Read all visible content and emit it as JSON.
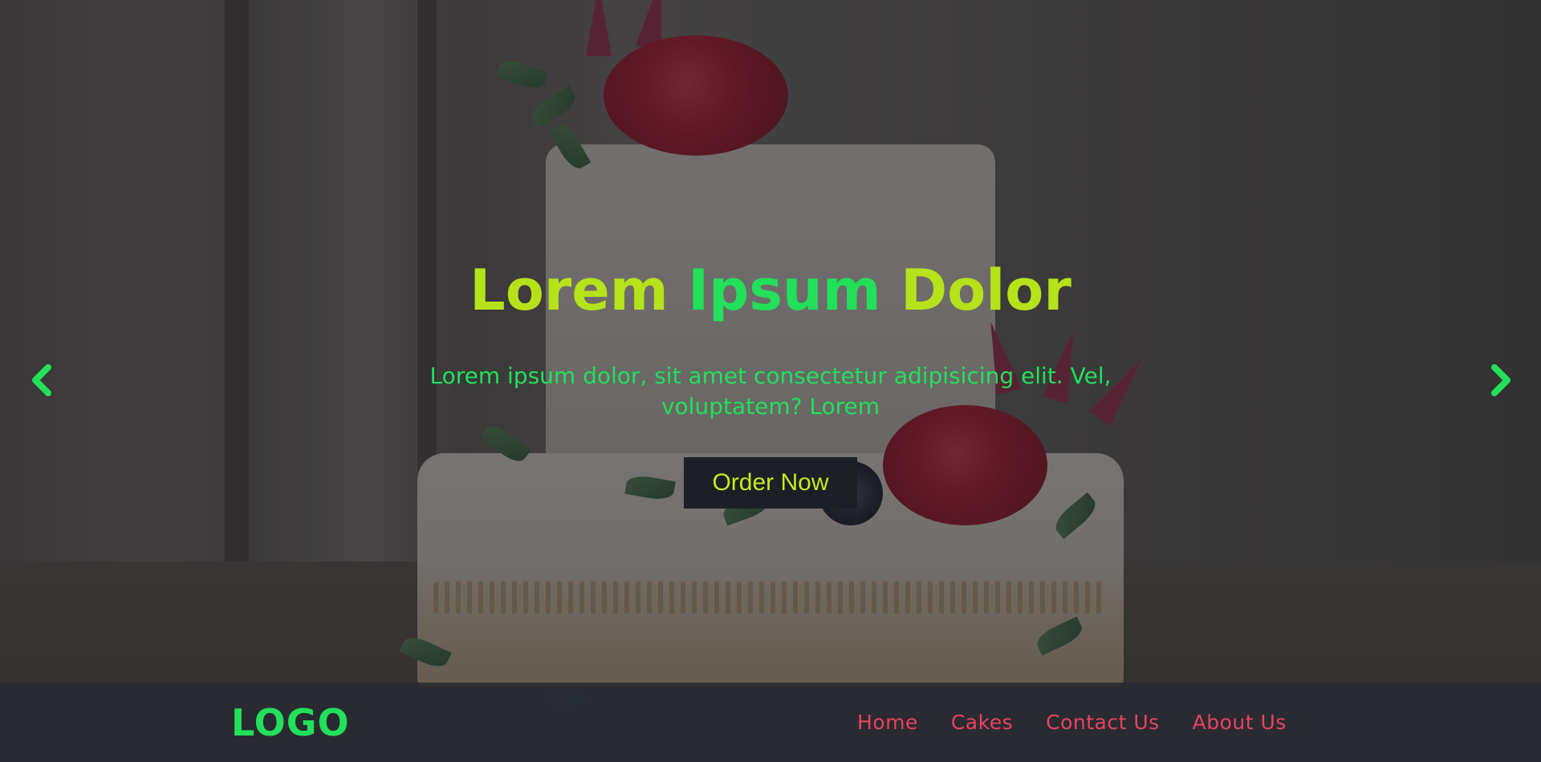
{
  "hero": {
    "title_part1": "Lorem ",
    "title_part2": "Ipsum",
    "title_part3": " Dolor",
    "text": "Lorem ipsum dolor, sit amet consectetur adipisicing elit. Vel, voluptatem? Lorem",
    "cta_label": "Order Now",
    "prev_icon": "chevron-left-icon",
    "next_icon": "chevron-right-icon"
  },
  "navbar": {
    "logo": "LOGO",
    "links": [
      "Home",
      "Cakes",
      "Contact Us",
      "About Us"
    ]
  },
  "colors": {
    "title_primary": "#b7e21a",
    "accent_green": "#22e05a",
    "nav_link": "#e9425f",
    "button_bg": "#1d1f26",
    "button_text": "#c8e81c"
  }
}
